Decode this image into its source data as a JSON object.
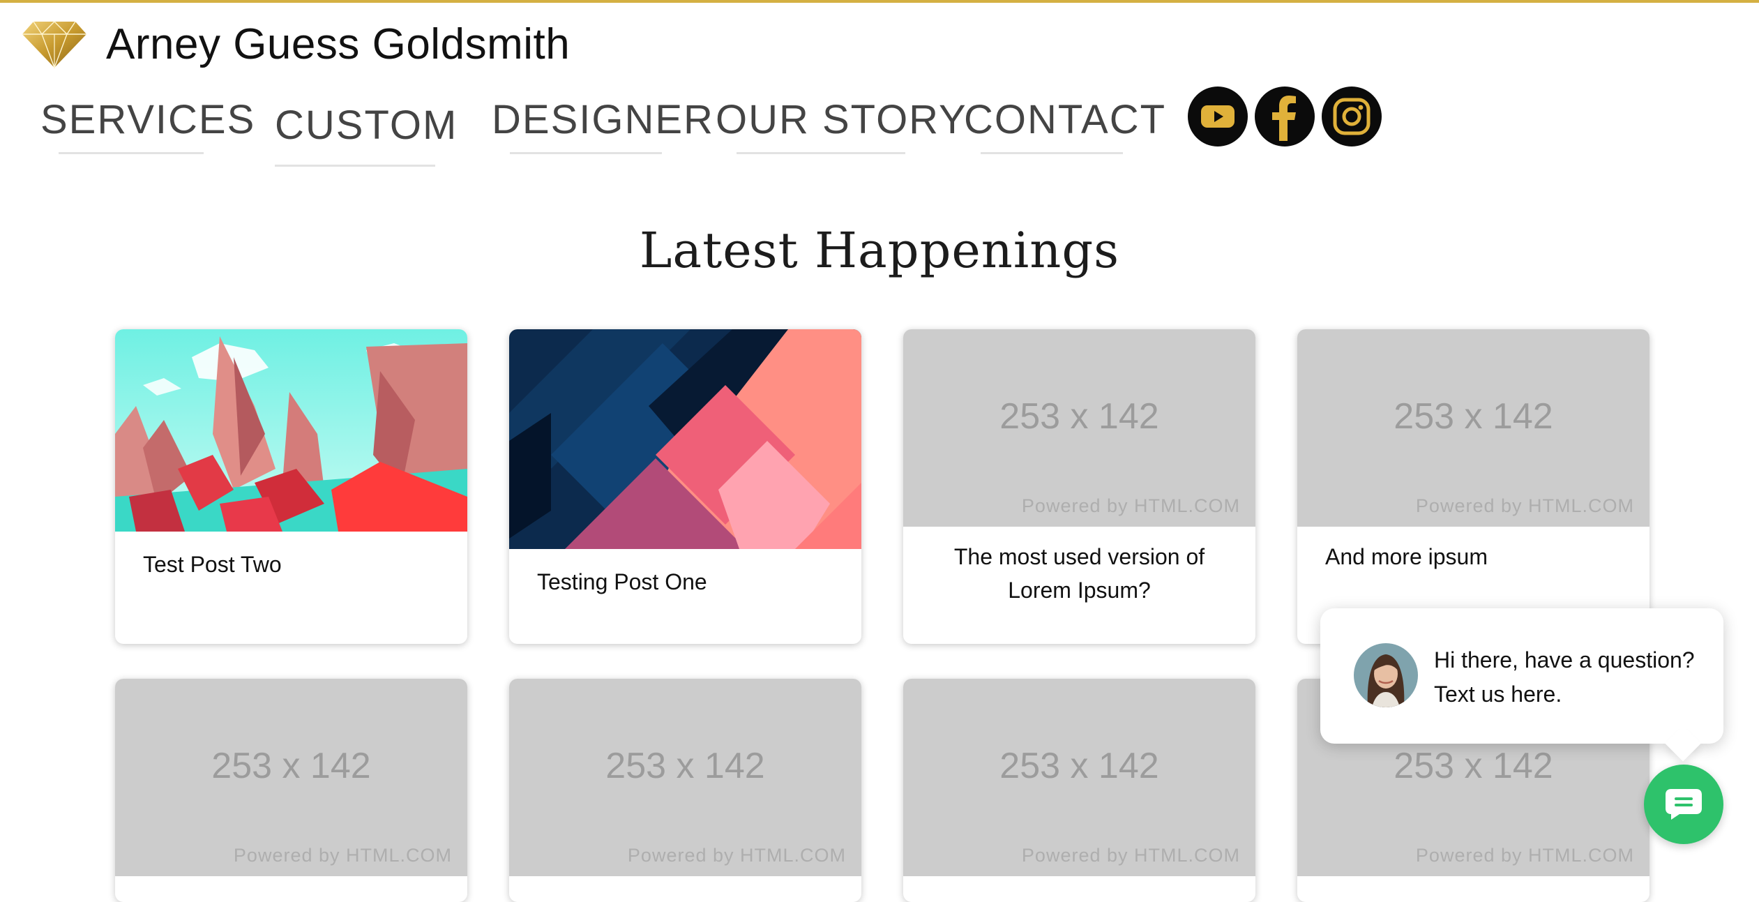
{
  "brand": {
    "name": "Arney Guess Goldsmith",
    "logo_icon": "diamond-icon",
    "accent": "#d4b042"
  },
  "nav": {
    "items": [
      {
        "label": "SERVICES"
      },
      {
        "label": "CUSTOM"
      },
      {
        "label": "DESIGNER"
      },
      {
        "label": "OUR STORY"
      },
      {
        "label": "CONTACT"
      }
    ]
  },
  "social": [
    {
      "icon": "youtube-icon"
    },
    {
      "icon": "facebook-icon"
    },
    {
      "icon": "instagram-icon"
    }
  ],
  "section": {
    "heading": "Latest Happenings"
  },
  "posts": [
    {
      "title": "Test Post Two",
      "image": "low-poly-landscape"
    },
    {
      "title": "Testing Post One",
      "image": "abstract-geometric"
    },
    {
      "title": "The most used version of Lorem Ipsum?",
      "image": "placeholder",
      "placeholder_size": "253 x 142",
      "placeholder_credit": "Powered by HTML.COM"
    },
    {
      "title": "And more ipsum",
      "image": "placeholder",
      "placeholder_size": "253 x 142",
      "placeholder_credit": "Powered by HTML.COM"
    },
    {
      "image": "placeholder",
      "placeholder_size": "253 x 142",
      "placeholder_credit": "Powered by HTML.COM"
    },
    {
      "image": "placeholder",
      "placeholder_size": "253 x 142",
      "placeholder_credit": "Powered by HTML.COM"
    },
    {
      "image": "placeholder",
      "placeholder_size": "253 x 142",
      "placeholder_credit": "Powered by HTML.COM"
    },
    {
      "image": "placeholder",
      "placeholder_size": "253 x 142",
      "placeholder_credit": "Powered by HTML.COM"
    }
  ],
  "chat": {
    "message": "Hi there, have a question? Text us here.",
    "button_icon": "chat-icon",
    "button_color": "#2ec26b"
  }
}
